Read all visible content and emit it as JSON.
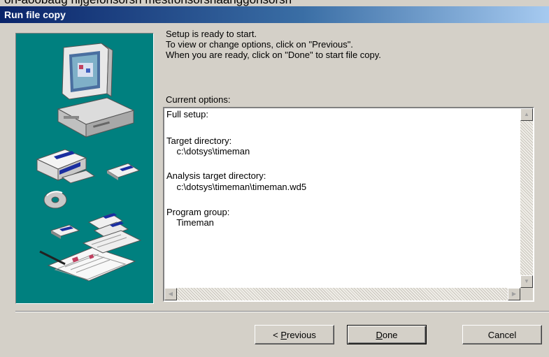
{
  "bleed_text": "on-aoobaug hijgefonsorsn mestfonsorsnaanggonsorsn",
  "window": {
    "title": "Run file copy"
  },
  "messages": [
    "Setup is ready to start.",
    "To view or change options, click on \"Previous\".",
    "When you are ready, click on \"Done\" to start file copy."
  ],
  "options": {
    "label": "Current options:",
    "lines": [
      "Full setup:",
      "",
      "Target directory:",
      "    c:\\dotsys\\timeman",
      "",
      "Analysis target directory:",
      "    c:\\dotsys\\timeman\\timeman.wd5",
      "",
      "Program group:",
      "    Timeman"
    ]
  },
  "buttons": {
    "previous": {
      "prefix": "< ",
      "accel": "P",
      "rest": "revious"
    },
    "done": {
      "accel": "D",
      "rest": "one"
    },
    "cancel": {
      "label": "Cancel"
    }
  },
  "colors": {
    "panel_bg": "#00807f",
    "titlebar": "#0a246a",
    "window_bg": "#d4d0c8"
  }
}
